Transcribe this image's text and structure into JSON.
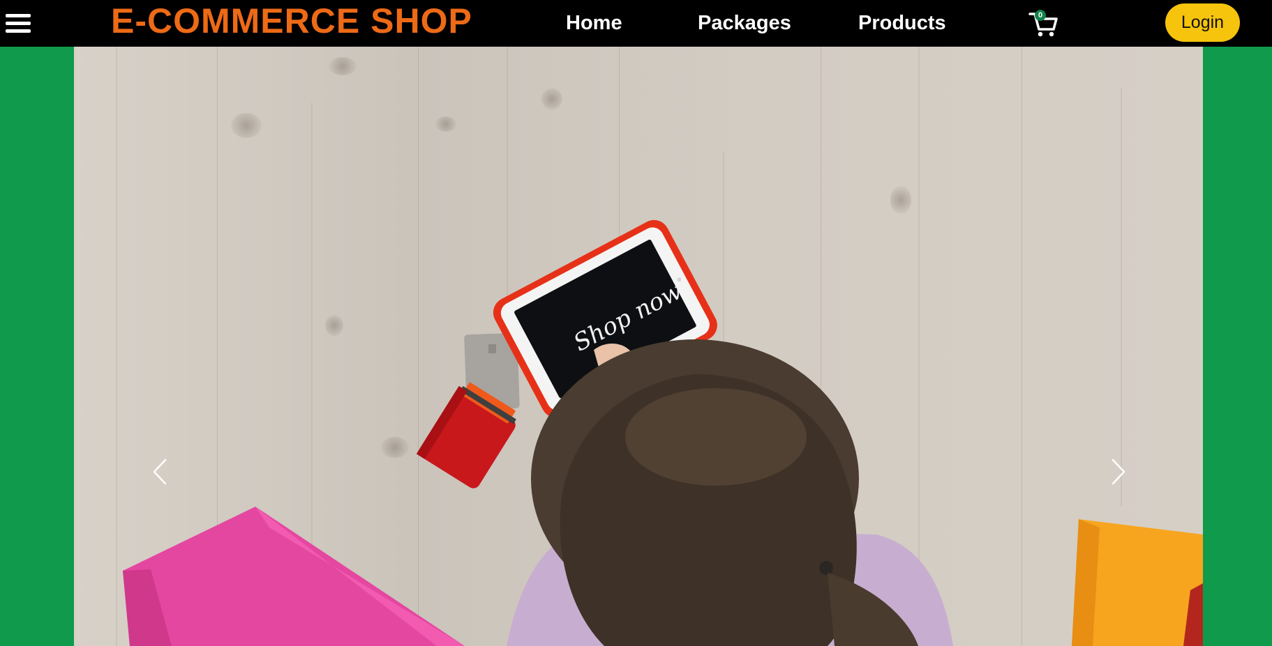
{
  "navbar": {
    "brand": "E-COMMERCE SHOP",
    "links": [
      {
        "label": "Home"
      },
      {
        "label": "Packages"
      },
      {
        "label": "Products"
      }
    ],
    "cart_count": "0",
    "login_label": "Login"
  },
  "carousel": {
    "image_text": "Shop now"
  },
  "colors": {
    "page_background": "#0f9a4c",
    "navbar_background": "#000000",
    "brand": "#ed6a16",
    "login_button": "#f6c40c",
    "cart_badge": "#12814a"
  },
  "icons": [
    "hamburger-menu-icon",
    "shopping-cart-icon",
    "chevron-left-icon",
    "chevron-right-icon"
  ]
}
